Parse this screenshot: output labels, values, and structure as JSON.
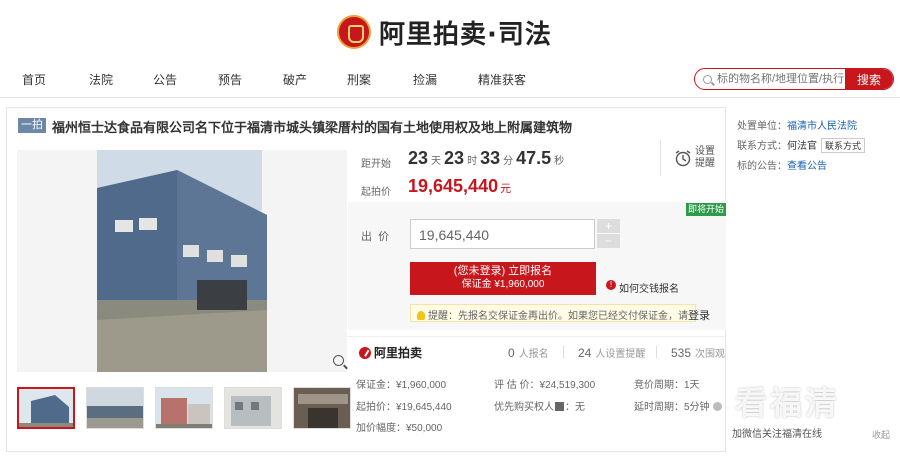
{
  "header": {
    "logo_text": "阿里拍卖·司法"
  },
  "nav": {
    "items": [
      "首页",
      "法院",
      "公告",
      "预告",
      "破产",
      "刑案",
      "捡漏",
      "精准获客"
    ]
  },
  "search": {
    "placeholder": "标的物名称/地理位置/执行案号",
    "button": "搜索"
  },
  "lot": {
    "tag": "一拍",
    "title": "福州恒士达食品有限公司名下位于福清市城头镇梁厝村的国有土地使用权及地上附属建筑物"
  },
  "countdown": {
    "label": "距开始",
    "days": "23",
    "days_unit": "天",
    "hours": "23",
    "hours_unit": "时",
    "minutes": "33",
    "minutes_unit": "分",
    "seconds": "47.5",
    "seconds_unit": "秒"
  },
  "start_price": {
    "label": "起拍价",
    "value": "19,645,440",
    "unit": "元"
  },
  "remind": {
    "label": "设置\n提醒"
  },
  "bid": {
    "badge": "即将开始",
    "label": "出  价",
    "input_value": "19,645,440",
    "plus": "+",
    "minus": "−",
    "register_line1": "(您未登录) 立即报名",
    "register_line2": "保证金 ¥1,960,000",
    "help_link": "如何交钱报名",
    "tip": "提醒：先报名交保证金再出价。如果您已经交付保证金，请",
    "tip_link": "登录"
  },
  "stats": {
    "brand": "阿里拍卖",
    "signup_count": "0",
    "signup_label": "人报名",
    "remind_count": "24",
    "remind_label": "人设置提醒",
    "view_count": "535",
    "view_label": "次围观"
  },
  "details": {
    "deposit": "保证金：¥1,960,000",
    "appraisal": "评 估 价：¥24,519,300",
    "cycle": "竞价周期：1天",
    "start_price": "起拍价：¥19,645,440",
    "priority": "优先购买权人",
    "priority_value": "：无",
    "delay": "延时周期：5分钟",
    "increment": "加价幅度：¥50,000"
  },
  "side": {
    "court_label": "处置单位：",
    "court": "福清市人民法院",
    "contact_label": "联系方式：",
    "contact_name": "何法官",
    "contact_button": "联系方式",
    "notice_label": "标的公告：",
    "notice_link": "查看公告"
  },
  "watermark": {
    "big": "看福清",
    "small": "加微信关注福清在线",
    "collapse": "收起"
  },
  "colors": {
    "accent": "#c8161d",
    "badge_green": "#2d9b4a",
    "tag_blue": "#6c87a8"
  }
}
